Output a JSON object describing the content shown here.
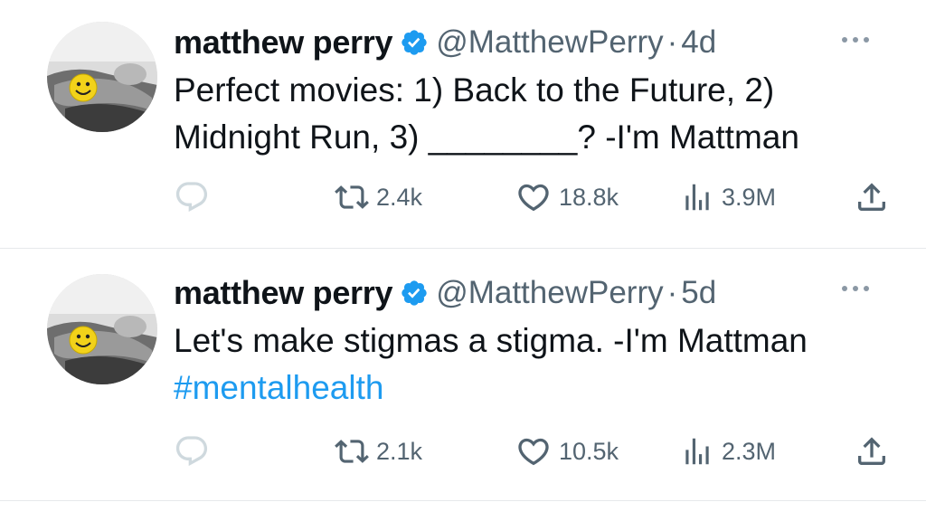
{
  "colors": {
    "text": "#0f1419",
    "secondary": "#536471",
    "link": "#1d9bf0",
    "verified": "#1d9bf0",
    "divider": "#e6e9eb"
  },
  "tweets": [
    {
      "author": {
        "name": "matthew perry",
        "handle": "@MatthewPerry",
        "verified": true
      },
      "separator": "·",
      "time": "4d",
      "text_lines": [
        "Perfect movies: 1) Back to the Future, 2)",
        "Midnight Run, 3) ________? -I'm Mattman"
      ],
      "hashtag": "",
      "stats": {
        "retweets": "2.4k",
        "likes": "18.8k",
        "views": "3.9M"
      },
      "icons": [
        "reply-icon",
        "retweet-icon",
        "like-icon",
        "views-icon",
        "share-icon",
        "more-icon",
        "verified-badge-icon"
      ]
    },
    {
      "author": {
        "name": "matthew perry",
        "handle": "@MatthewPerry",
        "verified": true
      },
      "separator": "·",
      "time": "5d",
      "text_lines": [
        "Let's make stigmas a stigma. -I'm Mattman"
      ],
      "hashtag": "#mentalhealth",
      "stats": {
        "retweets": "2.1k",
        "likes": "10.5k",
        "views": "2.3M"
      },
      "icons": [
        "reply-icon",
        "retweet-icon",
        "like-icon",
        "views-icon",
        "share-icon",
        "more-icon",
        "verified-badge-icon"
      ]
    }
  ]
}
